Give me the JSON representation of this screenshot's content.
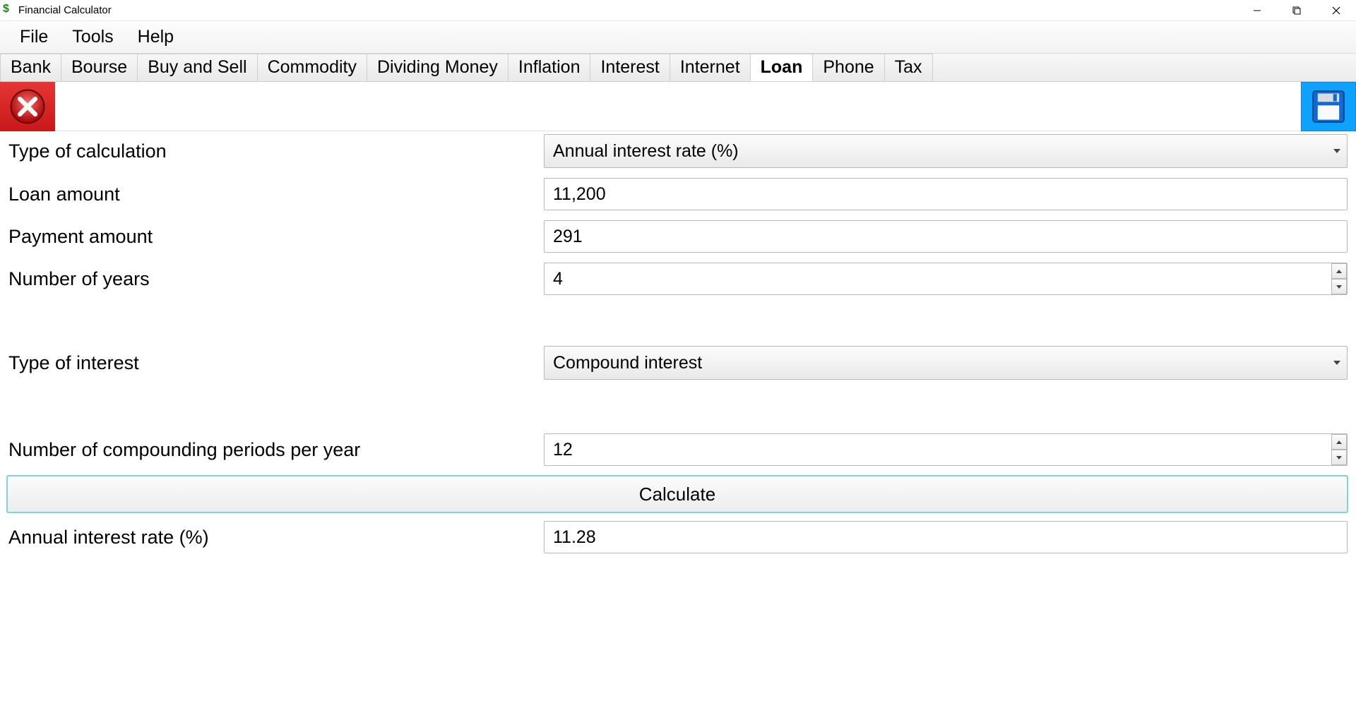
{
  "window": {
    "title": "Financial Calculator"
  },
  "menubar": {
    "items": [
      "File",
      "Tools",
      "Help"
    ]
  },
  "tabs": {
    "items": [
      "Bank",
      "Bourse",
      "Buy and Sell",
      "Commodity",
      "Dividing Money",
      "Inflation",
      "Interest",
      "Internet",
      "Loan",
      "Phone",
      "Tax"
    ],
    "active_index": 8
  },
  "form": {
    "type_of_calculation": {
      "label": "Type of calculation",
      "value": "Annual interest rate (%)"
    },
    "loan_amount": {
      "label": "Loan amount",
      "value": "11,200"
    },
    "payment_amount": {
      "label": "Payment amount",
      "value": "291"
    },
    "number_of_years": {
      "label": "Number of years",
      "value": "4"
    },
    "type_of_interest": {
      "label": "Type of interest",
      "value": "Compound interest"
    },
    "compounding_periods": {
      "label": "Number of compounding periods per year",
      "value": "12"
    },
    "calculate_label": "Calculate",
    "result": {
      "label": "Annual interest rate (%)",
      "value": "11.28"
    }
  }
}
